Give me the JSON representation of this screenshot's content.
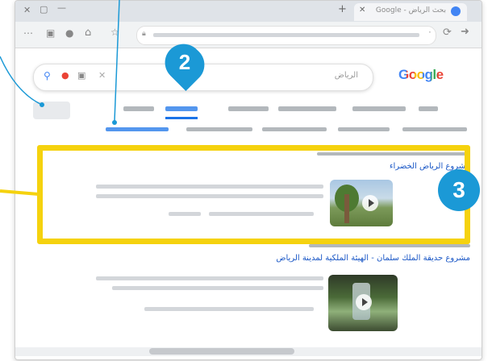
{
  "browser": {
    "tab_title": "Google - بحث الرياض"
  },
  "search": {
    "query": "الرياض",
    "logo_text": "Google"
  },
  "results": [
    {
      "title": "مشروع الرياض الخضراء"
    },
    {
      "title": "مشروع حديقة الملك سلمان - الهيئة الملكية لمدينة الرياض"
    }
  ],
  "callouts": {
    "two": "2",
    "three": "3"
  },
  "colors": {
    "highlight": "#f5d20e",
    "callout": "#1b99d6",
    "link": "#1a57c6"
  }
}
